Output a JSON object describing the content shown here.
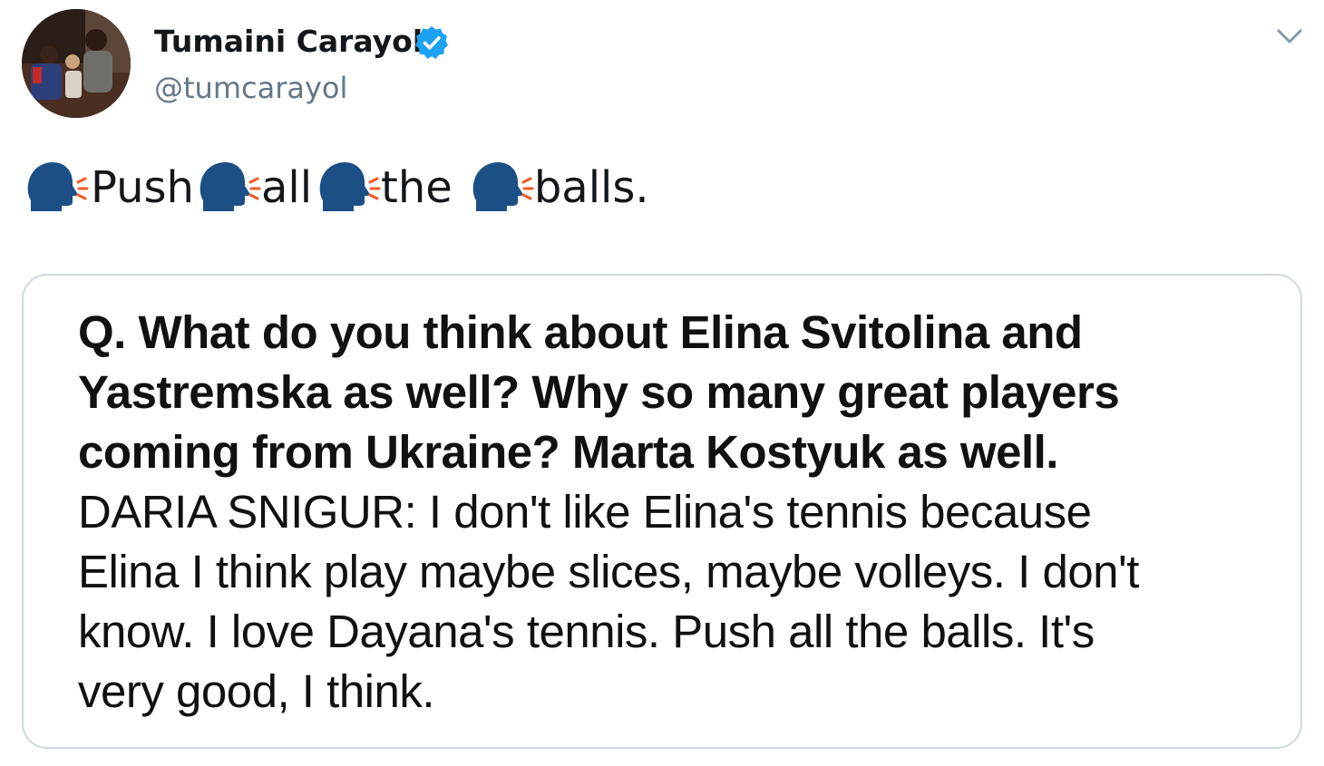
{
  "author": {
    "display_name": "Tumaini Carayol",
    "handle": "@tumcarayol",
    "verified": true,
    "verified_color": "#1da1f2"
  },
  "tweet": {
    "emoji_icon": "speaking-head-icon",
    "words": [
      "Push",
      "all",
      "the",
      "balls."
    ]
  },
  "quote": {
    "question_lines": [
      "Q. What do you think about Elina Svitolina and",
      "Yastremska as well?  Why so many great players",
      "coming from Ukraine?  Marta Kostyuk as well."
    ],
    "answer_lines": [
      "DARIA SNIGUR: I don't like Elina's tennis because",
      "Elina I think play maybe slices, maybe volleys.  I don't",
      "know.  I love Dayana's tennis.  Push all the balls.  It's",
      "very good, I think."
    ]
  },
  "colors": {
    "text": "#14171a",
    "secondary_text": "#657786",
    "card_border": "#cfd9de",
    "emoji_head": "#1b4f85",
    "emoji_voice": "#f05a28"
  }
}
